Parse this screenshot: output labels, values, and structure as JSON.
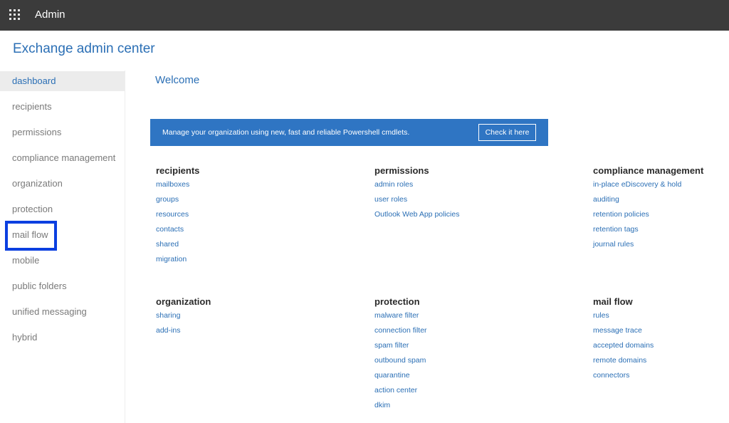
{
  "topbar": {
    "app_name": "Admin",
    "launcher_icon": "waffle-icon"
  },
  "page_title": "Exchange admin center",
  "sidebar": {
    "items": [
      {
        "label": "dashboard",
        "active": true
      },
      {
        "label": "recipients"
      },
      {
        "label": "permissions"
      },
      {
        "label": "compliance management"
      },
      {
        "label": "organization"
      },
      {
        "label": "protection"
      },
      {
        "label": "mail flow",
        "highlighted": true
      },
      {
        "label": "mobile"
      },
      {
        "label": "public folders"
      },
      {
        "label": "unified messaging"
      },
      {
        "label": "hybrid"
      }
    ]
  },
  "main": {
    "welcome": "Welcome",
    "banner": {
      "text": "Manage your organization using new, fast and reliable Powershell cmdlets.",
      "button": "Check it here"
    },
    "sections": [
      {
        "title": "recipients",
        "links": [
          "mailboxes",
          "groups",
          "resources",
          "contacts",
          "shared",
          "migration"
        ]
      },
      {
        "title": "permissions",
        "links": [
          "admin roles",
          "user roles",
          "Outlook Web App policies"
        ]
      },
      {
        "title": "compliance management",
        "links": [
          "in-place eDiscovery & hold",
          "auditing",
          "retention policies",
          "retention tags",
          "journal rules"
        ]
      },
      {
        "title": "organization",
        "links": [
          "sharing",
          "add-ins"
        ]
      },
      {
        "title": "protection",
        "links": [
          "malware filter",
          "connection filter",
          "spam filter",
          "outbound spam",
          "quarantine",
          "action center",
          "dkim"
        ]
      },
      {
        "title": "mail flow",
        "links": [
          "rules",
          "message trace",
          "accepted domains",
          "remote domains",
          "connectors"
        ]
      }
    ]
  },
  "colors": {
    "topbar": "#3b3b3b",
    "accent": "#2b6fb5",
    "banner": "#2f75c3",
    "highlight": "#0b3fe0"
  }
}
